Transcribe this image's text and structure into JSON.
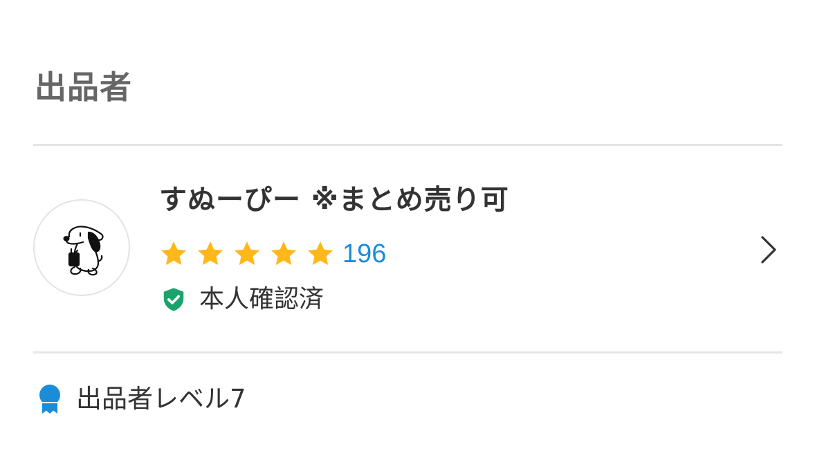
{
  "section": {
    "title": "出品者"
  },
  "seller": {
    "name": "すぬーぴー ※まとめ売り可",
    "avatar_icon": "snoopy-avatar",
    "rating": {
      "stars": 5,
      "max_stars": 5,
      "count": "196",
      "star_color": "#ffb818",
      "count_color": "#1a8cd8"
    },
    "verified": {
      "icon": "shield-check-icon",
      "label": "本人確認済",
      "color": "#1aa36b"
    },
    "chevron_icon": "chevron-right-icon"
  },
  "level": {
    "icon": "badge-ribbon-icon",
    "label": "出品者レベル7",
    "color": "#1a8cd8"
  },
  "colors": {
    "divider": "#e5e5e5",
    "title_text": "#666666",
    "body_text": "#333333"
  }
}
